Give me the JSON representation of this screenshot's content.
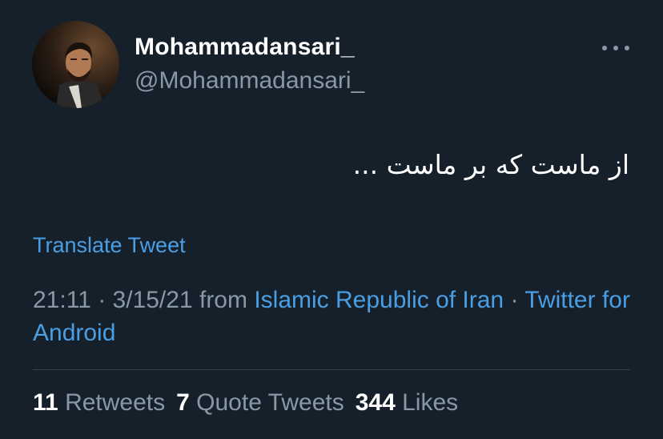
{
  "author": {
    "display_name": "Mohammadansari_",
    "handle": "@Mohammadansari_"
  },
  "tweet": {
    "text": "از ماست که بر ماست ...",
    "translate_label": "Translate Tweet"
  },
  "meta": {
    "time": "21:11",
    "separator": "·",
    "date": "3/15/21",
    "from_label": "from",
    "location": "Islamic Republic of Iran",
    "source": "Twitter for Android"
  },
  "stats": {
    "retweets_count": "11",
    "retweets_label": "Retweets",
    "quote_tweets_count": "7",
    "quote_tweets_label": "Quote Tweets",
    "likes_count": "344",
    "likes_label": "Likes"
  },
  "colors": {
    "background": "#15202b",
    "link": "#4a9fe4",
    "secondary_text": "#8899a6",
    "divider": "#38444d"
  },
  "icons": {
    "more": "more-horizontal-icon"
  }
}
